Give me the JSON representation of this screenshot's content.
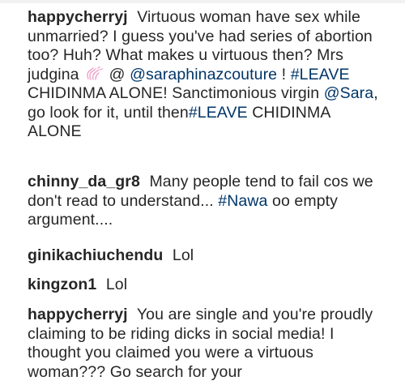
{
  "comments": [
    {
      "username": "happycherryj",
      "text_1": "Virtuous woman have sex while unmarried? I guess you've had series of abortion too? Huh? What makes u virtuous then? Mrs judgina",
      "emoji": "clapping-hands-icon",
      "text_2": "@",
      "mention_1": "@saraphinazcouture",
      "text_3": "!",
      "hashtag_1": "#LEAVE",
      "text_4": "CHIDINMA ALONE! Sanctimonious virgin",
      "mention_2": "@Sara",
      "text_5": ", go look for it, until then",
      "hashtag_2": "#LEAVE",
      "text_6": "CHIDINMA ALONE"
    },
    {
      "username": "chinny_da_gr8",
      "text_1": "Many people tend to fail cos we don't read to understand...",
      "hashtag": "#Nawa",
      "text_2": "oo empty argument...."
    },
    {
      "username": "ginikachiuchendu",
      "text": "Lol"
    },
    {
      "username": "kingzon1",
      "text": "Lol"
    },
    {
      "username": "happycherryj",
      "text": "You are single and you're proudly claiming to be riding dicks in social media! I thought you claimed you were a virtuous woman??? Go search for your"
    }
  ],
  "colors": {
    "text": "#262626",
    "link": "#003569",
    "emoji": "#f0a0c8"
  }
}
